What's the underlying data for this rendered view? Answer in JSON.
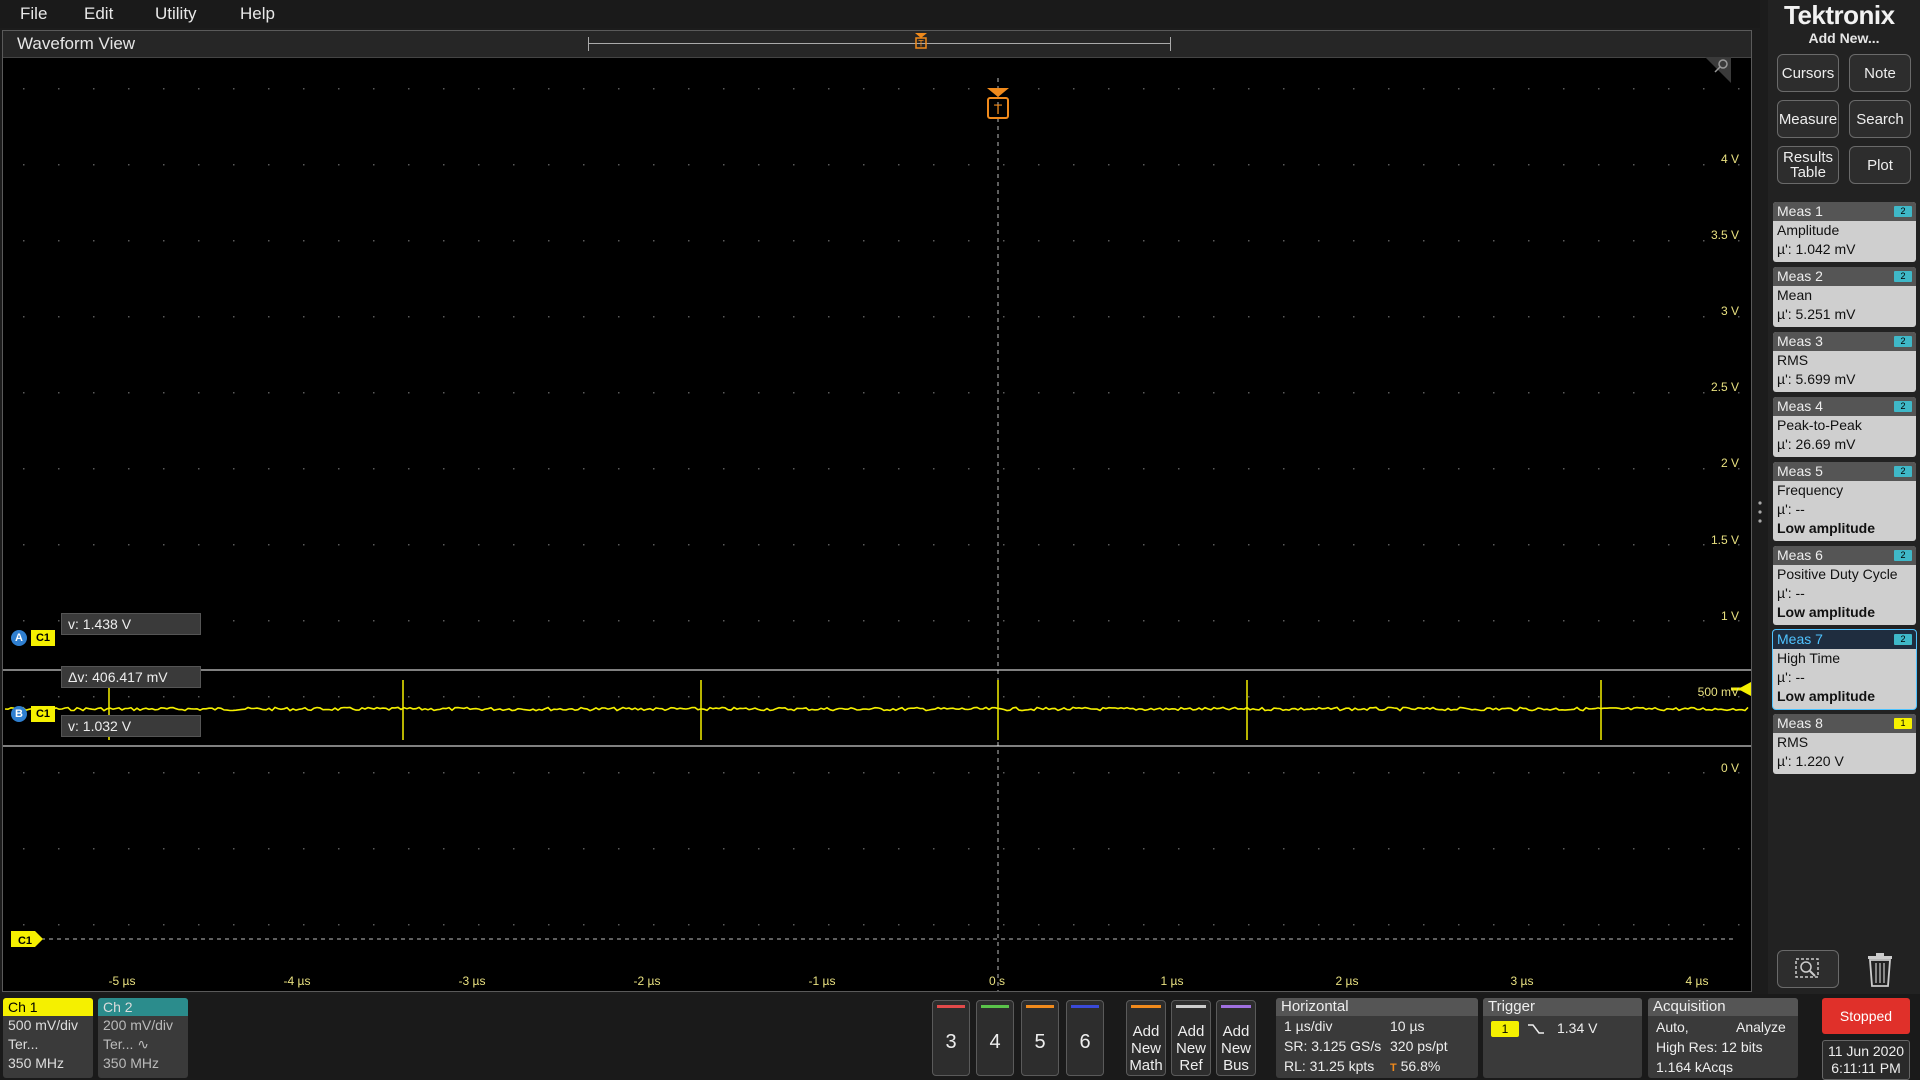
{
  "menu": [
    "File",
    "Edit",
    "Utility",
    "Help"
  ],
  "waveform_view": {
    "title": "Waveform View",
    "y_labels": [
      "4 V",
      "3.5 V",
      "3 V",
      "2.5 V",
      "2 V",
      "1.5 V",
      "1 V",
      "500 mV",
      "0 V"
    ],
    "x_labels": [
      "-5 µs",
      "-4 µs",
      "-3 µs",
      "-2 µs",
      "-1 µs",
      "0 s",
      "1 µs",
      "2 µs",
      "3 µs",
      "4 µs"
    ],
    "trigger_marker": "T",
    "channel_marker": "C1",
    "cursor_a": {
      "tag": "A",
      "channel": "C1",
      "readout": "v: 1.438 V"
    },
    "cursor_b": {
      "tag": "B",
      "channel": "C1",
      "readout": "v: 1.032 V"
    },
    "delta_readout": "Δv: 406.417 mV",
    "colors": {
      "ch1": "#f5f000",
      "cursor": "#ffffff",
      "trigger": "#f08a1c",
      "grid": "#4a4a4a"
    }
  },
  "right_panel": {
    "logo": "Tektronix",
    "add_new": "Add New...",
    "buttons": {
      "cursors": "Cursors",
      "note": "Note",
      "measure": "Measure",
      "search": "Search",
      "results_table_1": "Results",
      "results_table_2": "Table",
      "plot": "Plot"
    },
    "measurements": [
      {
        "title": "Meas 1",
        "badge": "2",
        "name": "Amplitude",
        "value": "µ': 1.042 mV",
        "note": ""
      },
      {
        "title": "Meas 2",
        "badge": "2",
        "name": "Mean",
        "value": "µ': 5.251 mV",
        "note": ""
      },
      {
        "title": "Meas 3",
        "badge": "2",
        "name": "RMS",
        "value": "µ': 5.699 mV",
        "note": ""
      },
      {
        "title": "Meas 4",
        "badge": "2",
        "name": "Peak-to-Peak",
        "value": "µ': 26.69 mV",
        "note": ""
      },
      {
        "title": "Meas 5",
        "badge": "2",
        "name": "Frequency",
        "value": "µ': --",
        "note": "Low amplitude"
      },
      {
        "title": "Meas 6",
        "badge": "2",
        "name": "Positive Duty Cycle",
        "value": "µ': --",
        "note": "Low amplitude"
      },
      {
        "title": "Meas 7",
        "badge": "2",
        "name": "High Time",
        "value": "µ': --",
        "note": "Low amplitude"
      },
      {
        "title": "Meas 8",
        "badge": "1",
        "name": "RMS",
        "value": "µ': 1.220 V",
        "note": ""
      }
    ]
  },
  "bottom": {
    "ch1": {
      "title": "Ch 1",
      "scale": "500 mV/div",
      "term": "Ter...",
      "bw": "350 MHz"
    },
    "ch2": {
      "title": "Ch 2",
      "scale": "200 mV/div",
      "term": "Ter...",
      "coupling": "∿",
      "bw": "350 MHz"
    },
    "channel_buttons": [
      "3",
      "4",
      "5",
      "6"
    ],
    "add_math": [
      "Add",
      "New",
      "Math"
    ],
    "add_ref": [
      "Add",
      "New",
      "Ref"
    ],
    "add_bus": [
      "Add",
      "New",
      "Bus"
    ],
    "horizontal": {
      "title": "Horizontal",
      "scale": "1 µs/div",
      "duration": "10 µs",
      "sample_rate": "SR: 3.125 GS/s",
      "resolution": "320 ps/pt",
      "record_length": "RL: 31.25 kpts",
      "position": "56.8%",
      "position_icon": "T"
    },
    "trigger": {
      "title": "Trigger",
      "source": "1",
      "level": "1.34 V"
    },
    "acquisition": {
      "title": "Acquisition",
      "mode": "Auto,",
      "action": "Analyze",
      "resolution": "High Res: 12 bits",
      "acqs": "1.164 kAcqs"
    },
    "status": "Stopped",
    "date": "11 Jun 2020",
    "time": "6:11:11 PM"
  }
}
